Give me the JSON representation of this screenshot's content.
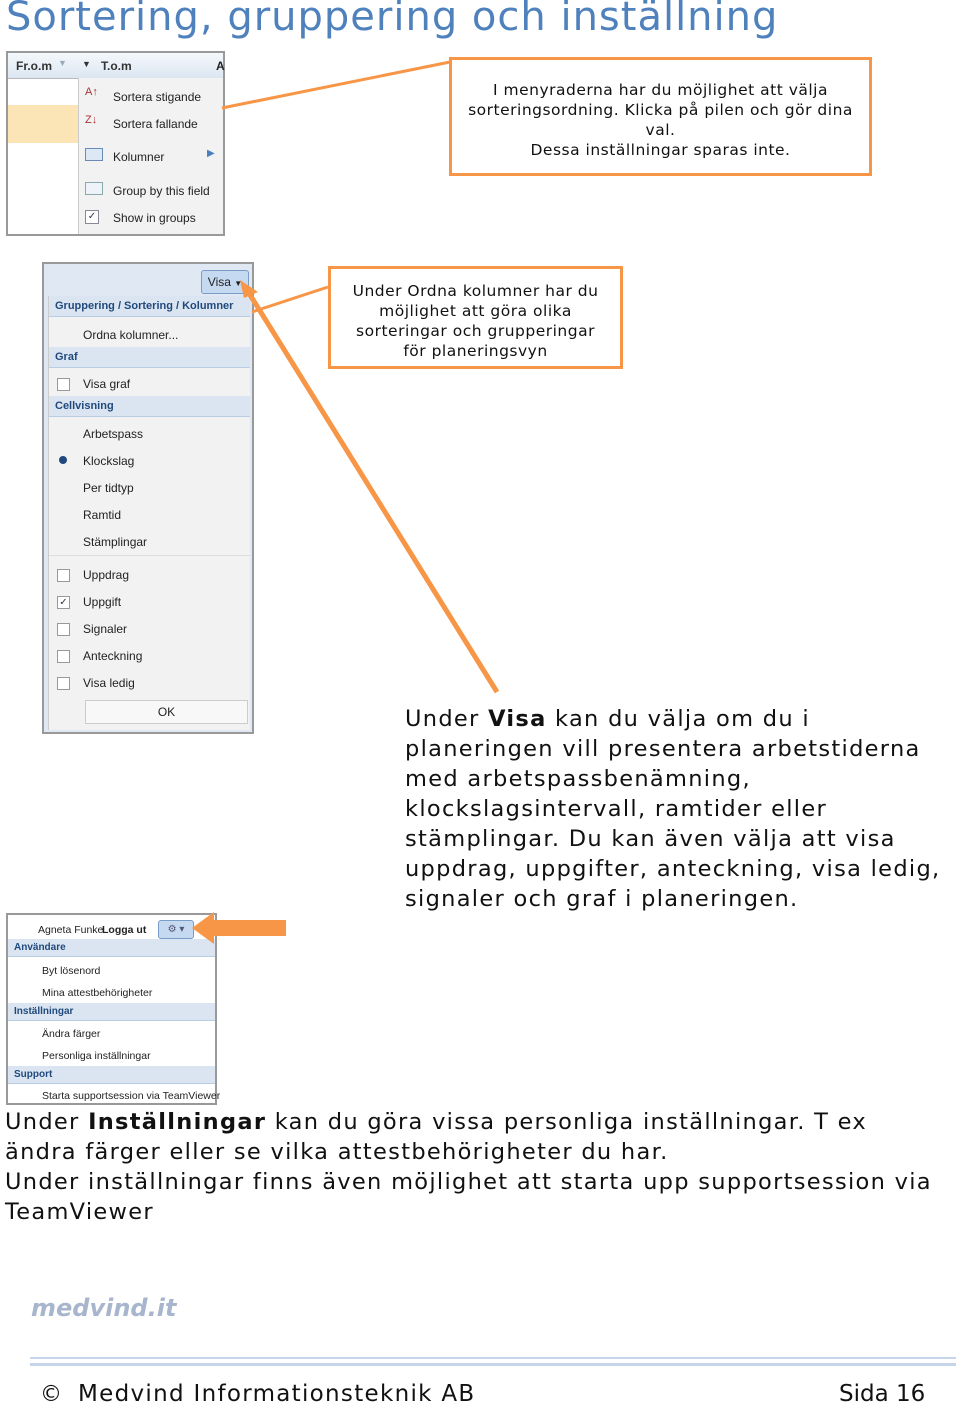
{
  "title": "Sortering, gruppering och inställning",
  "callouts": {
    "c1": [
      "I menyraderna har du möjlighet att välja",
      "sorteringsordning. Klicka på pilen och gör dina",
      "val.",
      "Dessa inställningar sparas inte."
    ],
    "c2": [
      "Under Ordna kolumner har du",
      "möjlighet att göra olika",
      "sorteringar och grupperingar",
      "för planeringsvyn"
    ]
  },
  "shot1": {
    "col1": "Fr.o.m",
    "col2": "T.o.m",
    "col3": "A",
    "items": [
      "Sortera stigande",
      "Sortera fallande",
      "Kolumner",
      "Group by this field",
      "Show in groups"
    ]
  },
  "shot2": {
    "button": "Visa",
    "h1": "Gruppering / Sortering / Kolumner",
    "ordna": "Ordna kolumner...",
    "h2": "Graf",
    "visa_graf": "Visa graf",
    "h3": "Cellvisning",
    "cell": [
      "Arbetspass",
      "Klockslag",
      "Per tidtyp",
      "Ramtid",
      "Stämplingar"
    ],
    "checks": [
      "Uppdrag",
      "Uppgift",
      "Signaler",
      "Anteckning",
      "Visa ledig"
    ],
    "ok": "OK"
  },
  "para1": {
    "pre": "Under ",
    "bold": "Visa",
    "post": " kan du välja om du i planeringen vill presentera arbetstiderna med arbetspassbenämning, klockslagsintervall, ramtider eller stämplingar. Du kan även välja att visa uppdrag, uppgifter, anteckning, visa ledig, signaler och graf i planeringen."
  },
  "shot3": {
    "user": "Agneta Funke",
    "logout": "Logga ut",
    "h1": "Användare",
    "i1": "Byt lösenord",
    "i2": "Mina attestbehörigheter",
    "h2": "Inställningar",
    "i3": "Ändra färger",
    "i4": "Personliga inställningar",
    "h3": "Support",
    "i5": "Starta supportsession via TeamViewer"
  },
  "para2": {
    "pre": "Under ",
    "bold": "Inställningar",
    "post": " kan du göra vissa personliga inställningar. T ex ändra färger eller se vilka attestbehörigheter du har.",
    "line2": "Under inställningar finns även möjlighet att starta upp supportsession via TeamViewer"
  },
  "footer": {
    "logo": "medvind.it",
    "copyright": "©",
    "company": "Medvind Informationsteknik AB",
    "page": "Sida 16"
  },
  "colors": {
    "accent": "#f79646",
    "heading": "#4f81bd"
  }
}
